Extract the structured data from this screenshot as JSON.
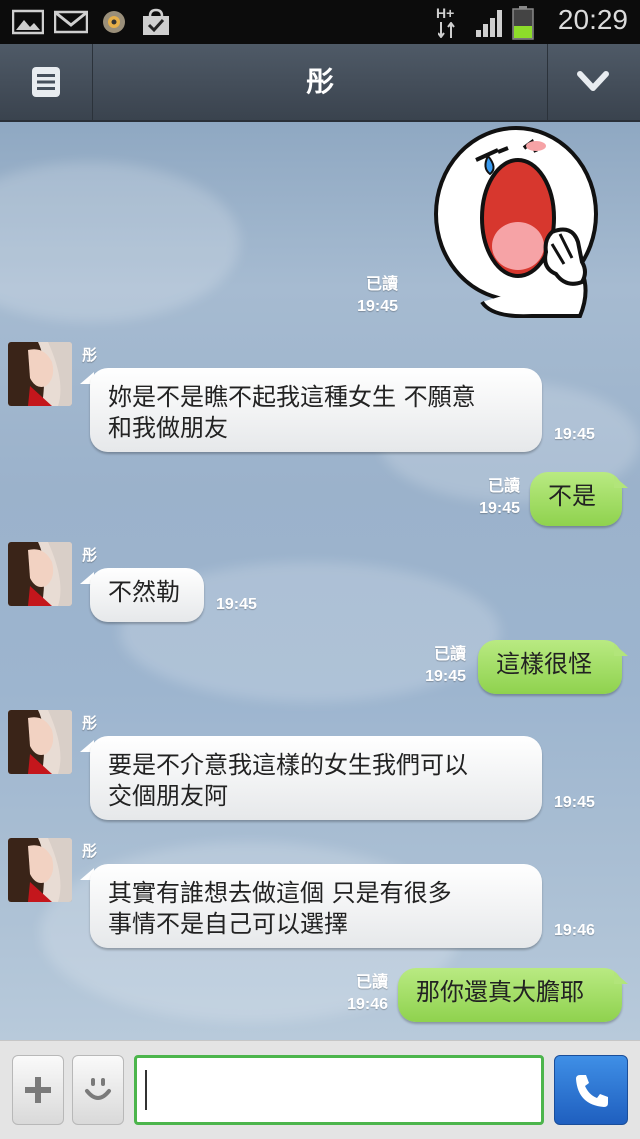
{
  "status_bar": {
    "network": "H+",
    "time": "20:29",
    "icons": [
      "gallery-icon",
      "gmail-icon",
      "mascot-notification-icon",
      "shopping-bag-icon",
      "signal-icon",
      "battery-icon"
    ]
  },
  "header": {
    "title": "彤",
    "left_icon": "menu-list-icon",
    "right_icon": "chevron-down-icon"
  },
  "messages": [
    {
      "direction": "out",
      "type": "sticker",
      "sticker": "crying-face-sticker",
      "read": "已讀",
      "time": "19:45"
    },
    {
      "direction": "in",
      "sender": "彤",
      "lines": [
        "妳是不是瞧不起我這種女生  不願意",
        "和我做朋友"
      ],
      "time": "19:45"
    },
    {
      "direction": "out",
      "text": "不是",
      "read": "已讀",
      "time": "19:45"
    },
    {
      "direction": "in",
      "sender": "彤",
      "lines": [
        "不然勒"
      ],
      "time": "19:45"
    },
    {
      "direction": "out",
      "text": "這樣很怪",
      "read": "已讀",
      "time": "19:45"
    },
    {
      "direction": "in",
      "sender": "彤",
      "lines": [
        "要是不介意我這樣的女生我們可以",
        "交個朋友阿"
      ],
      "time": "19:45"
    },
    {
      "direction": "in",
      "sender": "彤",
      "lines": [
        "其實有誰想去做這個    只是有很多",
        "事情不是自己可以選擇"
      ],
      "time": "19:46"
    },
    {
      "direction": "out",
      "text": "那你還真大膽耶",
      "read": "已讀",
      "time": "19:46"
    }
  ],
  "input_bar": {
    "plus_icon": "plus-icon",
    "emoji_icon": "smiley-icon",
    "message_value": "",
    "call_icon": "phone-icon"
  },
  "colors": {
    "header_bg": "#46505c",
    "outgoing_bubble": "#9bd95e",
    "incoming_bubble": "#ffffff",
    "input_border": "#4cb54c",
    "call_button": "#2e76d6"
  }
}
